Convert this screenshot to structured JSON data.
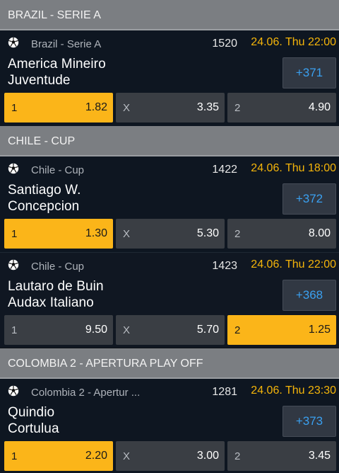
{
  "sections": [
    {
      "header": "BRAZIL - SERIE A",
      "matches": [
        {
          "league": "Brazil - Serie A",
          "id": "1520",
          "time": "24.06. Thu 22:00",
          "home": "America Mineiro",
          "away": "Juventude",
          "more": "+371",
          "odds": [
            {
              "label": "1",
              "value": "1.82",
              "selected": true
            },
            {
              "label": "X",
              "value": "3.35",
              "selected": false
            },
            {
              "label": "2",
              "value": "4.90",
              "selected": false
            }
          ]
        }
      ]
    },
    {
      "header": "CHILE - CUP",
      "matches": [
        {
          "league": "Chile - Cup",
          "id": "1422",
          "time": "24.06. Thu 18:00",
          "home": "Santiago W.",
          "away": "Concepcion",
          "more": "+372",
          "odds": [
            {
              "label": "1",
              "value": "1.30",
              "selected": true
            },
            {
              "label": "X",
              "value": "5.30",
              "selected": false
            },
            {
              "label": "2",
              "value": "8.00",
              "selected": false
            }
          ]
        },
        {
          "league": "Chile - Cup",
          "id": "1423",
          "time": "24.06. Thu 22:00",
          "home": "Lautaro de Buin",
          "away": "Audax Italiano",
          "more": "+368",
          "odds": [
            {
              "label": "1",
              "value": "9.50",
              "selected": false
            },
            {
              "label": "X",
              "value": "5.70",
              "selected": false
            },
            {
              "label": "2",
              "value": "1.25",
              "selected": true
            }
          ]
        }
      ]
    },
    {
      "header": "COLOMBIA 2 - APERTURA PLAY OFF",
      "matches": [
        {
          "league": "Colombia 2 - Apertur ...",
          "id": "1281",
          "time": "24.06. Thu 23:30",
          "home": "Quindio",
          "away": "Cortulua",
          "more": "+373",
          "odds": [
            {
              "label": "1",
              "value": "2.20",
              "selected": true
            },
            {
              "label": "X",
              "value": "3.00",
              "selected": false
            },
            {
              "label": "2",
              "value": "3.45",
              "selected": false
            }
          ]
        }
      ]
    }
  ],
  "colors": {
    "header_bg": "#7b7e82",
    "card_bg": "#101722",
    "odd_bg": "#3a3e44",
    "selected_bg": "#fbb519",
    "time_color": "#f5b50a",
    "more_color": "#3aa0f0"
  },
  "icons": {
    "sport": "soccer-ball-icon"
  }
}
